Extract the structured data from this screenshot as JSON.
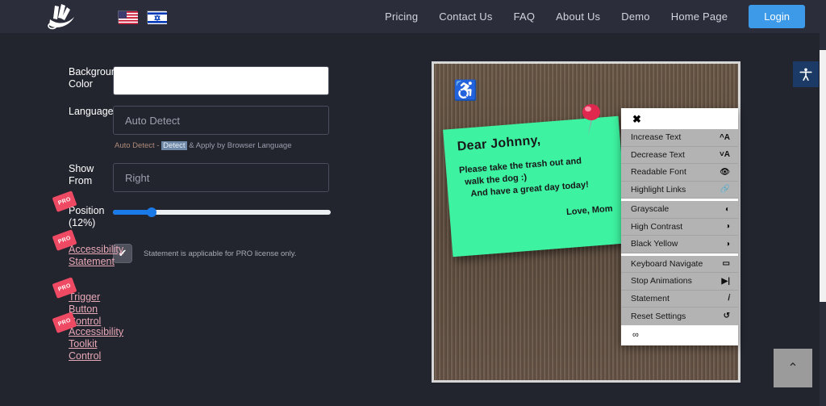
{
  "nav": {
    "logo_icon": "feather-pen-logo",
    "flags": [
      {
        "name": "flag-us",
        "label": "English (US)"
      },
      {
        "name": "flag-il",
        "label": "Hebrew (Israel)"
      }
    ],
    "links": [
      "Pricing",
      "Contact Us",
      "FAQ",
      "About Us",
      "Demo",
      "Home Page"
    ],
    "login_label": "Login",
    "accent": "#3c9ae8"
  },
  "settings": {
    "background_color": {
      "label": "Background Color",
      "value": "",
      "swatch": "#ffffff"
    },
    "language": {
      "label": "Language",
      "value": "Auto Detect",
      "hint_prefix": "Auto Detect - ",
      "hint_selected": "Detect",
      "hint_suffix": " & Apply by Browser Language"
    },
    "show_from": {
      "label": "Show From",
      "value": "Right"
    },
    "position": {
      "label": "Position (12%)",
      "percent": 12,
      "pro": true
    },
    "accessibility_statement": {
      "label": "Accessibility Statement",
      "pro": true,
      "checked": true,
      "note": "Statement is applicable for PRO license only."
    },
    "trigger_button_control": {
      "label": "Trigger Button Control",
      "pro": true
    },
    "accessibility_toolkit_control": {
      "label": "Accessibility Toolkit Control",
      "pro": true
    },
    "pro_badge": "PRO"
  },
  "demo": {
    "wheelchair_icon": "♿",
    "note": {
      "greeting": "Dear Johnny,",
      "line1": "Please take the trash out and",
      "line2": "walk the dog :)",
      "line3": "And have a great day today!",
      "signature": "Love, Mom"
    }
  },
  "toolkit": {
    "close_icon": "✖",
    "items": [
      {
        "label": "Increase Text",
        "icon": "^A"
      },
      {
        "label": "Decrease Text",
        "icon": "˅A"
      },
      {
        "label": "Readable Font",
        "icon": "👁"
      },
      {
        "label": "Highlight Links",
        "icon": "🔗"
      },
      {
        "label": "Grayscale",
        "icon": "◐"
      },
      {
        "label": "High Contrast",
        "icon": "◑"
      },
      {
        "label": "Black Yellow",
        "icon": "◑"
      },
      {
        "label": "Keyboard Navigate",
        "icon": "▭"
      },
      {
        "label": "Stop Animations",
        "icon": "▶|"
      },
      {
        "label": "Statement",
        "icon": "𝑖"
      },
      {
        "label": "Reset Settings",
        "icon": "↺"
      }
    ],
    "separator_after": [
      3,
      6
    ],
    "footer_icon": "∞"
  },
  "floating": {
    "a11y_trigger_icon": "accessibility-person-icon",
    "scroll_top_icon": "⌃"
  }
}
